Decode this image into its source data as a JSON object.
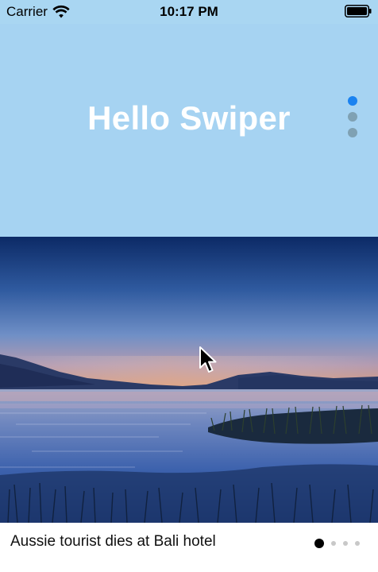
{
  "status_bar": {
    "carrier": "Carrier",
    "time": "10:17 PM",
    "icons": [
      "wifi-icon",
      "battery-icon"
    ]
  },
  "header": {
    "title": "Hello Swiper",
    "background_color": "#a6d3f2",
    "pagination": {
      "count": 3,
      "active_index": 0,
      "active_color": "#1a82f0",
      "inactive_color": "#7fa1b3"
    }
  },
  "slide": {
    "image": "lake-at-dusk",
    "caption": "Aussie tourist dies at Bali hotel",
    "pagination": {
      "count": 4,
      "active_index": 0,
      "active_color": "#000000",
      "inactive_color": "#c8c8c8"
    }
  },
  "pointer": "cursor-arrow-icon"
}
